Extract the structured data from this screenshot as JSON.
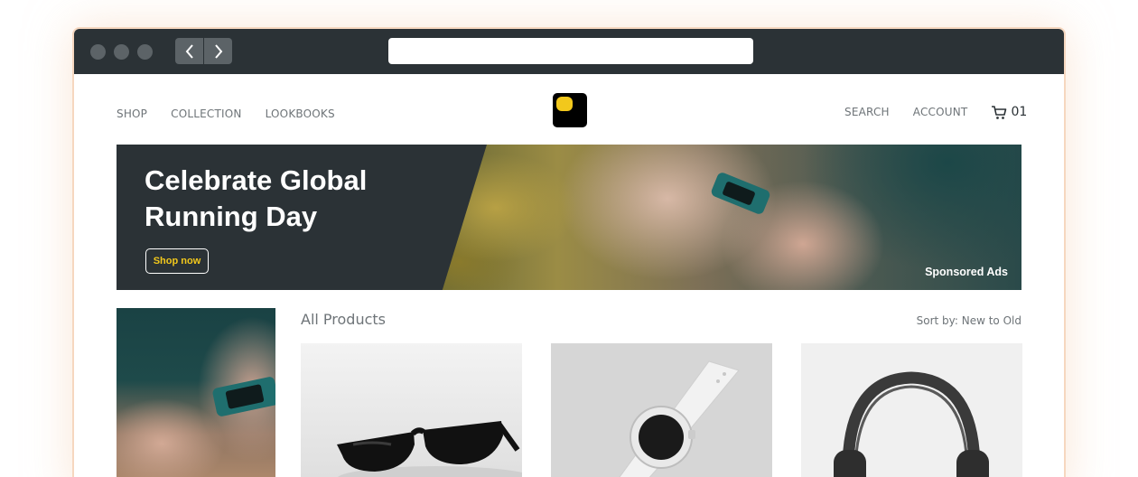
{
  "nav": {
    "shop": "SHOP",
    "collection": "COLLECTION",
    "lookbooks": "LOOKBOOKS",
    "search": "SEARCH",
    "account": "ACCOUNT",
    "cart_count": "01"
  },
  "hero": {
    "title": "Celebrate Global Running Day",
    "cta": "Shop now",
    "sponsored": "Sponsored Ads"
  },
  "products": {
    "section_title": "All Products",
    "sort_label": "Sort by: New to Old",
    "items": [
      {
        "name": "sunglasses"
      },
      {
        "name": "smartwatch"
      },
      {
        "name": "headphones"
      }
    ]
  },
  "colors": {
    "titlebar": "#2b3236",
    "accent_yellow": "#f2c81c",
    "window_border": "#f6d7bf",
    "text_gray": "#6e7478"
  },
  "icons": {
    "back": "chevron-left-icon",
    "forward": "chevron-right-icon",
    "cart": "cart-icon"
  }
}
